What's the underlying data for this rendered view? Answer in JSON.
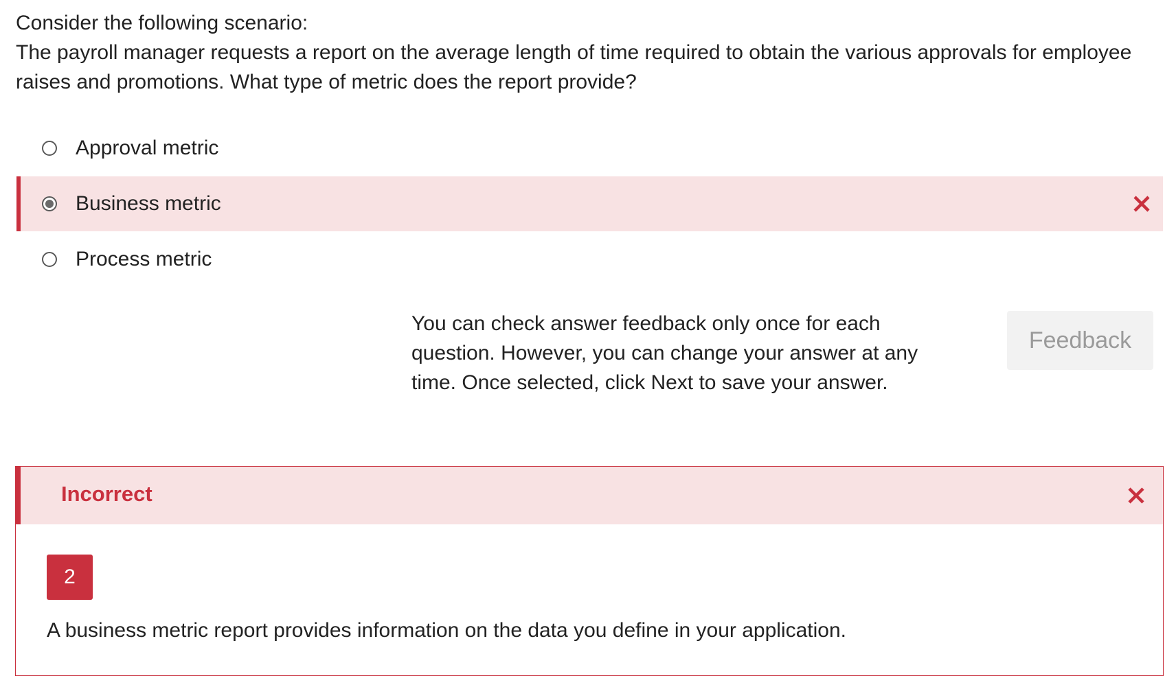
{
  "question": {
    "intro": "Consider the following scenario:",
    "text": "The payroll manager requests a report on the average length of time required to obtain the various approvals for employee raises and promotions. What type of metric does the report provide?"
  },
  "options": [
    {
      "label": "Approval metric",
      "selected": false
    },
    {
      "label": "Business metric",
      "selected": true,
      "marked": "incorrect"
    },
    {
      "label": "Process metric",
      "selected": false
    }
  ],
  "note": "You can check answer feedback only once for each question. However, you can change your answer at any time. Once selected, click Next to save your answer.",
  "feedback_button": "Feedback",
  "result": {
    "title": "Incorrect",
    "badge": "2",
    "explanation": "A business metric report provides information on the data you define in your application."
  },
  "colors": {
    "error": "#c9303e",
    "error_bg": "#f8e2e3",
    "button_bg": "#f2f2f2",
    "button_text": "#9a9a9a"
  },
  "icons": {
    "incorrect": "close-icon"
  }
}
